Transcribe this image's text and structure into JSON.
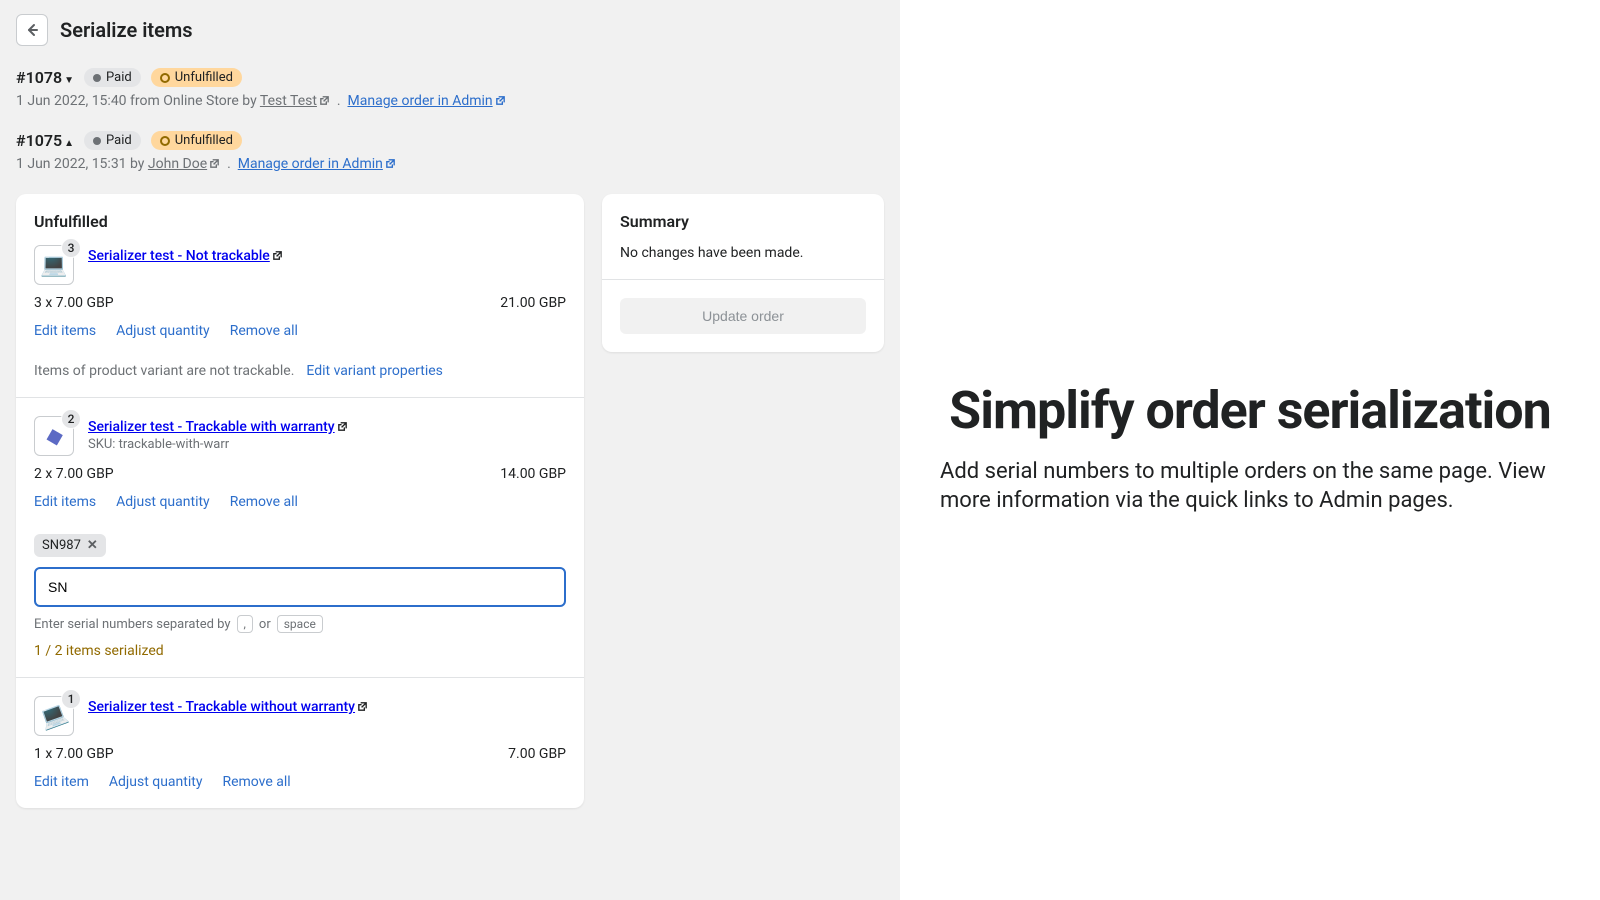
{
  "page_title": "Serialize items",
  "orders": [
    {
      "id": "#1078",
      "paid_label": "Paid",
      "fulfill_label": "Unfulfilled",
      "meta_prefix": "1 Jun 2022, 15:40 from Online Store by ",
      "author": "Test Test",
      "admin_link": "Manage order in Admin"
    },
    {
      "id": "#1075",
      "paid_label": "Paid",
      "fulfill_label": "Unfulfilled",
      "meta_prefix": "1 Jun 2022, 15:31 by ",
      "author": "John Doe",
      "admin_link": "Manage order in Admin"
    }
  ],
  "unfulfilled_title": "Unfulfilled",
  "items": [
    {
      "qty_badge": "3",
      "title": "Serializer test - Not trackable",
      "qty_price": "3 x 7.00 GBP",
      "total": "21.00 GBP",
      "edit": "Edit items",
      "adjust": "Adjust quantity",
      "remove": "Remove all",
      "note": "Items of product variant are not trackable.",
      "note_link": "Edit variant properties"
    },
    {
      "qty_badge": "2",
      "title": "Serializer test - Trackable with warranty",
      "sku": "SKU: trackable-with-warr",
      "qty_price": "2 x 7.00 GBP",
      "total": "14.00 GBP",
      "edit": "Edit items",
      "adjust": "Adjust quantity",
      "remove": "Remove all",
      "tag": "SN987",
      "input_value": "SN",
      "help_prefix": "Enter serial numbers separated by",
      "key1": ",",
      "help_or": "or",
      "key2": "space",
      "warning": "1 / 2 items serialized"
    },
    {
      "qty_badge": "1",
      "title": "Serializer test - Trackable without warranty",
      "qty_price": "1 x 7.00 GBP",
      "total": "7.00 GBP",
      "edit": "Edit item",
      "adjust": "Adjust quantity",
      "remove": "Remove all"
    }
  ],
  "summary": {
    "title": "Summary",
    "text": "No changes have been made.",
    "button": "Update order"
  },
  "promo": {
    "title": "Simplify order serialization",
    "body": "Add serial numbers to multiple orders on the same page. View more information via the quick links to Admin pages."
  }
}
